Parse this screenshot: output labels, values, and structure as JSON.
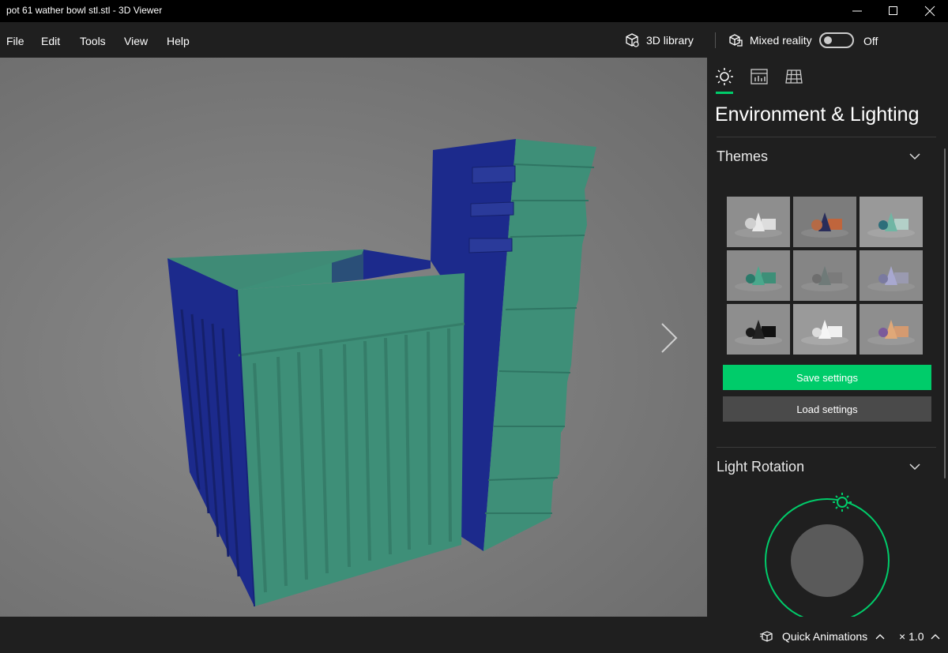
{
  "window": {
    "title": "pot 61 wather bowl stl.stl - 3D Viewer"
  },
  "menu": {
    "items": [
      "File",
      "Edit",
      "Tools",
      "View",
      "Help"
    ]
  },
  "toolbar": {
    "library_label": "3D library",
    "mixed_reality_label": "Mixed reality",
    "mixed_reality_state": "Off"
  },
  "panel": {
    "tabs": [
      {
        "icon": "sun-icon",
        "selected": true
      },
      {
        "icon": "stats-icon",
        "selected": false
      },
      {
        "icon": "grid-icon",
        "selected": false
      }
    ],
    "title": "Environment & Lighting",
    "themes_label": "Themes",
    "themes": [
      {
        "name": "white",
        "selected": false
      },
      {
        "name": "orange-navy",
        "selected": false
      },
      {
        "name": "teal-light",
        "selected": false
      },
      {
        "name": "teal",
        "selected": true
      },
      {
        "name": "gray",
        "selected": false
      },
      {
        "name": "lavender",
        "selected": false
      },
      {
        "name": "black",
        "selected": false
      },
      {
        "name": "bright-white",
        "selected": false
      },
      {
        "name": "peach-purple",
        "selected": false
      }
    ],
    "save_label": "Save settings",
    "load_label": "Load settings",
    "light_rotation_label": "Light Rotation"
  },
  "bottom": {
    "quick_animations_label": "Quick Animations",
    "speed_label": "× 1.0"
  },
  "colors": {
    "accent": "#00cc6a",
    "model_green": "#3e8f78",
    "model_blue": "#1c2a8c"
  }
}
